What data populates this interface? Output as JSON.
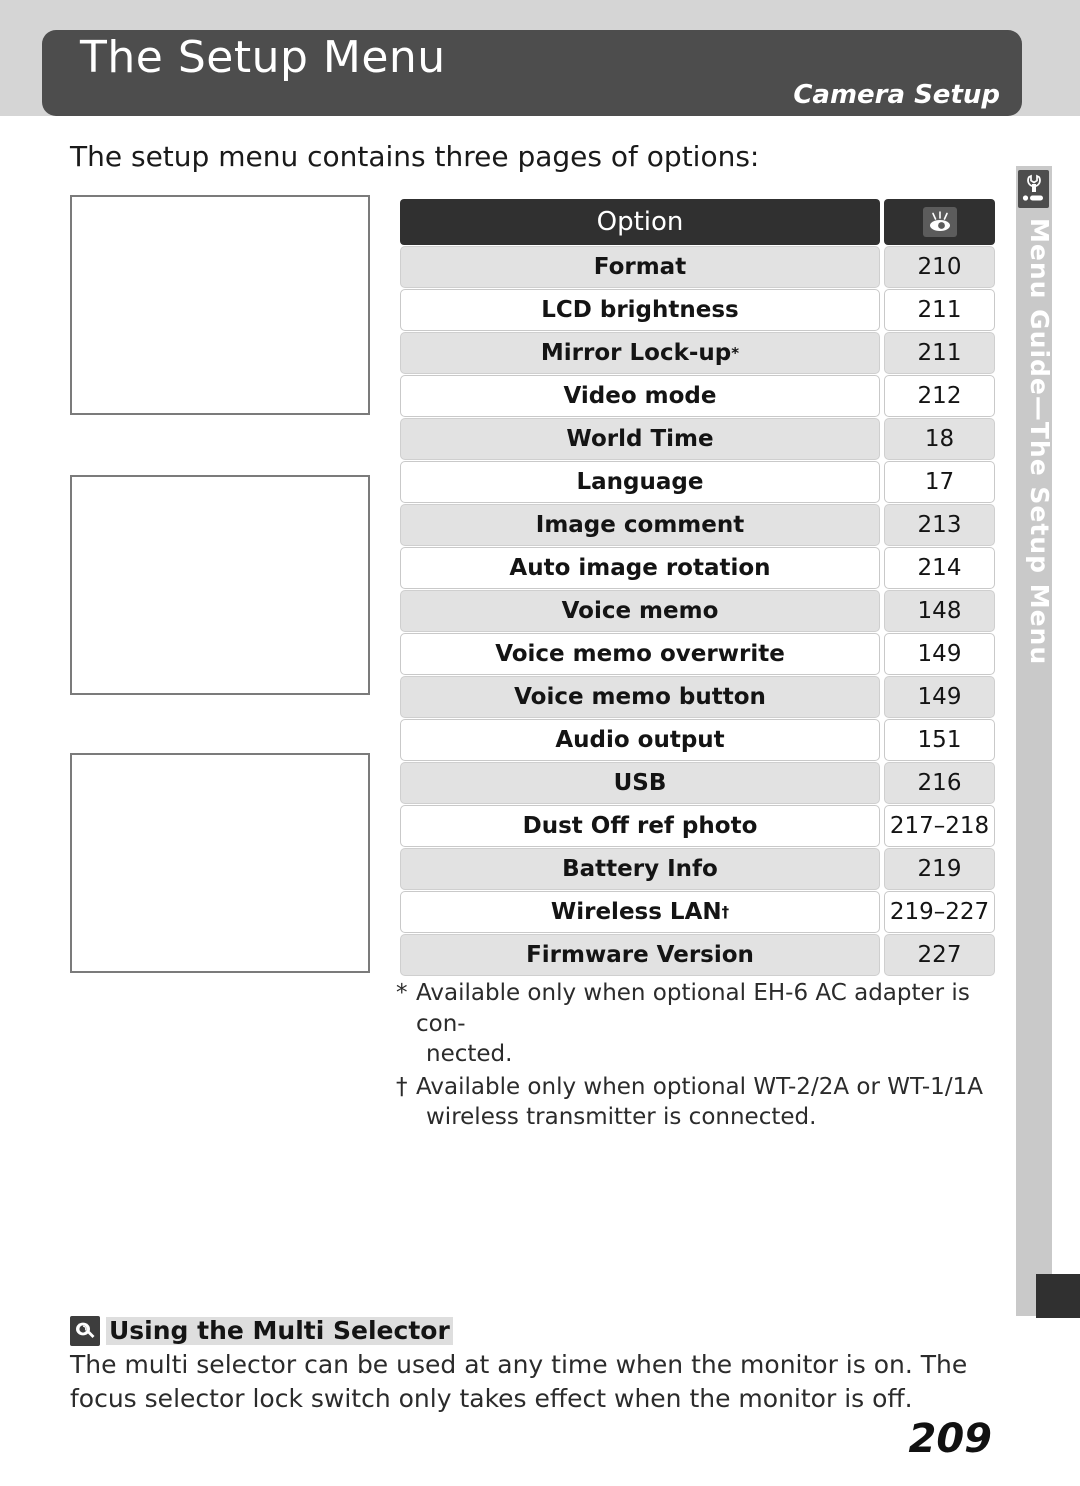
{
  "banner": {
    "title": "The Setup Menu",
    "subtitle": "Camera Setup"
  },
  "intro": "The setup menu contains three pages of options:",
  "table": {
    "header": {
      "option_label": "Option",
      "page_icon": "eye-icon"
    },
    "rows": [
      {
        "option": "Format",
        "page": "210"
      },
      {
        "option": "LCD brightness",
        "page": "211"
      },
      {
        "option": "Mirror Lock-up",
        "mark": "*",
        "page": "211"
      },
      {
        "option": "Video mode",
        "page": "212"
      },
      {
        "option": "World Time",
        "page": "18"
      },
      {
        "option": "Language",
        "page": "17"
      },
      {
        "option": "Image comment",
        "page": "213"
      },
      {
        "option": "Auto image rotation",
        "page": "214"
      },
      {
        "option": "Voice memo",
        "page": "148"
      },
      {
        "option": "Voice memo overwrite",
        "page": "149"
      },
      {
        "option": "Voice memo button",
        "page": "149"
      },
      {
        "option": "Audio output",
        "page": "151"
      },
      {
        "option": "USB",
        "page": "216"
      },
      {
        "option": "Dust Off ref photo",
        "page": "217–218"
      },
      {
        "option": "Battery Info",
        "page": "219"
      },
      {
        "option": "Wireless LAN",
        "mark": "†",
        "page": "219–227"
      },
      {
        "option": "Firmware Version",
        "page": "227"
      }
    ]
  },
  "footnotes": [
    {
      "mark": "*",
      "text": "Available only when optional EH-6 AC adapter is con-nected."
    },
    {
      "mark": "†",
      "text": "Available only when optional WT-2/2A or WT-1/1A wireless transmitter is connected."
    }
  ],
  "footnote_lines": [
    {
      "mark": "*",
      "line1": "Available only when optional EH-6 AC adapter is con-",
      "line2": "nected."
    },
    {
      "mark": "†",
      "line1": "Available only when optional WT-2/2A or WT-1/1A",
      "line2": "wireless transmitter is connected."
    }
  ],
  "side_tab": {
    "label": "Menu Guide—The Setup Menu",
    "icon": "wrench-setup-icon"
  },
  "tip": {
    "icon": "tip-bulb-icon",
    "title": "Using the Multi Selector",
    "body": "The multi selector can be used at any time when the monitor is on.  The focus selector lock switch only takes effect when the monitor is off."
  },
  "page_number": "209",
  "colors": {
    "banner_bg": "#4d4d4d",
    "band_bg": "#d5d5d5",
    "header_row_bg": "#303030",
    "shaded_row_bg": "#e2e2e2",
    "side_strip_bg": "#c9c9c9"
  }
}
